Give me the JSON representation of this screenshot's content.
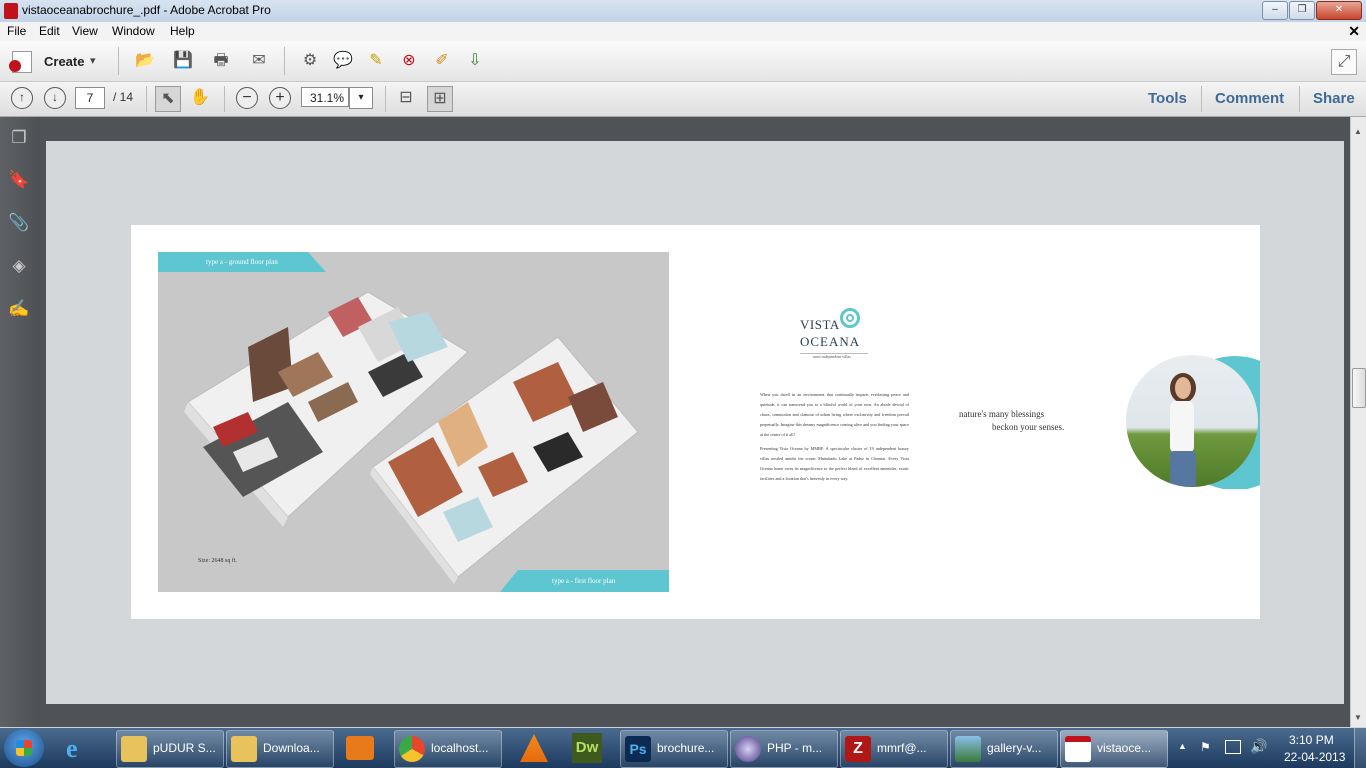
{
  "window": {
    "title": "vistaoceanabrochure_.pdf - Adobe Acrobat Pro",
    "controls": [
      "‒",
      "❐",
      "✕"
    ]
  },
  "menu": [
    "File",
    "Edit",
    "View",
    "Window",
    "Help"
  ],
  "toolbar": {
    "create_label": "Create",
    "create_arrow": "▾"
  },
  "nav": {
    "page_current": "7",
    "page_total": "/ 14",
    "zoom": "31.1%",
    "zoom_arrow": "▾"
  },
  "right_links": [
    "Tools",
    "Comment",
    "Share"
  ],
  "brochure": {
    "tag_ground": "type a - ground floor plan",
    "tag_first": "type a - first floor plan",
    "size": "Size: 2648 sq ft.",
    "logo_line1": "VISTA",
    "logo_line2": "OCEANA",
    "logo_tagline": "semi independent villas",
    "paragraph1": "When you dwell in an environment that continually imparts everlasting peace and quietude, it can transcend you to a blissful world of your own. An abode devoid of chaos, commotion and clamour of urban living where exclusivity and freedom prevail perpetually. Imagine this dreamy magnificence coming alive and you finding your space at the centre of it all!",
    "paragraph2": "Presenting Vista Oceana by MMRF. A spectacular cluster of 19 independent luxury villas nestled amidst the scenic Muttukadu Lake at Padur in Chennai. Every Vista Oceana home owes its magnificence to the perfect blend of excellent amenities, exotic facilities and a location that's heavenly in every way.",
    "quote_line1": "nature's many blessings",
    "quote_line2": "beckon your senses."
  },
  "taskbar": {
    "items": [
      "pUDUR S...",
      "Downloa...",
      "localhost...",
      "brochure...",
      "PHP - m...",
      "mmrf@...",
      "gallery-v...",
      "vistaoce..."
    ],
    "time": "3:10 PM",
    "date": "22-04-2013",
    "tray_arrow": "▲"
  },
  "colors": {
    "accent_teal": "#5ec6d1",
    "link_blue": "#3d6a96",
    "pdf_red": "#c0121a"
  }
}
